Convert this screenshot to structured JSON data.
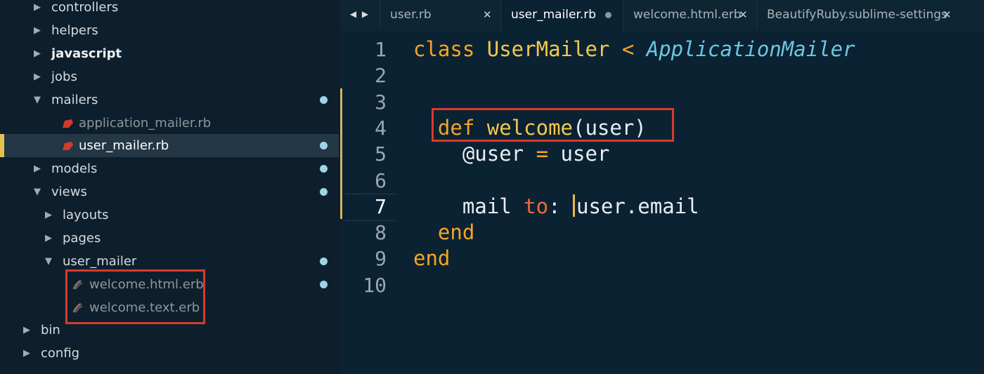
{
  "sidebar": {
    "items": [
      {
        "label": "controllers",
        "arrow": "▶",
        "modified": false
      },
      {
        "label": "helpers",
        "arrow": "▶",
        "modified": false
      },
      {
        "label": "javascript",
        "arrow": "▶",
        "modified": false
      },
      {
        "label": "jobs",
        "arrow": "▶",
        "modified": false
      },
      {
        "label": "mailers",
        "arrow": "▼",
        "modified": true
      },
      {
        "label": "application_mailer.rb",
        "icon": "ruby-file-icon",
        "modified": false
      },
      {
        "label": "user_mailer.rb",
        "icon": "ruby-file-icon",
        "modified": true,
        "selected": true
      },
      {
        "label": "models",
        "arrow": "▶",
        "modified": true
      },
      {
        "label": "views",
        "arrow": "▼",
        "modified": true
      },
      {
        "label": "layouts",
        "arrow": "▶",
        "modified": false
      },
      {
        "label": "pages",
        "arrow": "▶",
        "modified": false
      },
      {
        "label": "user_mailer",
        "arrow": "▼",
        "modified": true
      },
      {
        "label": "welcome.html.erb",
        "icon": "erb-file-icon",
        "modified": true
      },
      {
        "label": "welcome.text.erb",
        "icon": "erb-file-icon",
        "modified": false
      },
      {
        "label": "bin",
        "arrow": "▶",
        "modified": false
      },
      {
        "label": "config",
        "arrow": "▶",
        "modified": false
      }
    ]
  },
  "tabs": [
    {
      "label": "user.rb",
      "active": false,
      "state": "close"
    },
    {
      "label": "user_mailer.rb",
      "active": true,
      "state": "modified"
    },
    {
      "label": "welcome.html.erb",
      "active": false,
      "state": "close"
    },
    {
      "label": "BeautifyRuby.sublime-settings",
      "active": false,
      "state": "close"
    }
  ],
  "nav_arrows": "◀ ▶",
  "close_glyph": "✕",
  "editor": {
    "current_line": 7,
    "lines": [
      {
        "num": "1",
        "t": [
          [
            "kw",
            "class "
          ],
          [
            "cls",
            "UserMailer "
          ],
          [
            "op",
            "< "
          ],
          [
            "parent",
            "ApplicationMailer"
          ]
        ]
      },
      {
        "num": "2",
        "t": []
      },
      {
        "num": "3",
        "t": []
      },
      {
        "num": "4",
        "t": [
          [
            "plain",
            "  "
          ],
          [
            "kw",
            "def "
          ],
          [
            "fn",
            "welcome"
          ],
          [
            "plain",
            "(user)"
          ]
        ]
      },
      {
        "num": "5",
        "t": [
          [
            "plain",
            "    "
          ],
          [
            "ivar",
            "@user "
          ],
          [
            "op",
            "= "
          ],
          [
            "plain",
            "user"
          ]
        ]
      },
      {
        "num": "6",
        "t": []
      },
      {
        "num": "7",
        "t": [
          [
            "plain",
            "    mail "
          ],
          [
            "sym",
            "to"
          ],
          [
            "plain",
            ": "
          ],
          [
            "cursor",
            ""
          ],
          [
            "plain",
            "user.email"
          ]
        ]
      },
      {
        "num": "8",
        "t": [
          [
            "plain",
            "  "
          ],
          [
            "kw",
            "end"
          ]
        ]
      },
      {
        "num": "9",
        "t": [
          [
            "kw",
            "end"
          ]
        ]
      },
      {
        "num": "10",
        "t": []
      }
    ]
  },
  "colors": {
    "accent": "#e6c04d",
    "highlight_box": "#d83a2d",
    "modified_dot": "#9fd4e6",
    "keyword": "#f5a623",
    "class_name": "#f5c84c",
    "parent_class": "#6ec7e0"
  }
}
